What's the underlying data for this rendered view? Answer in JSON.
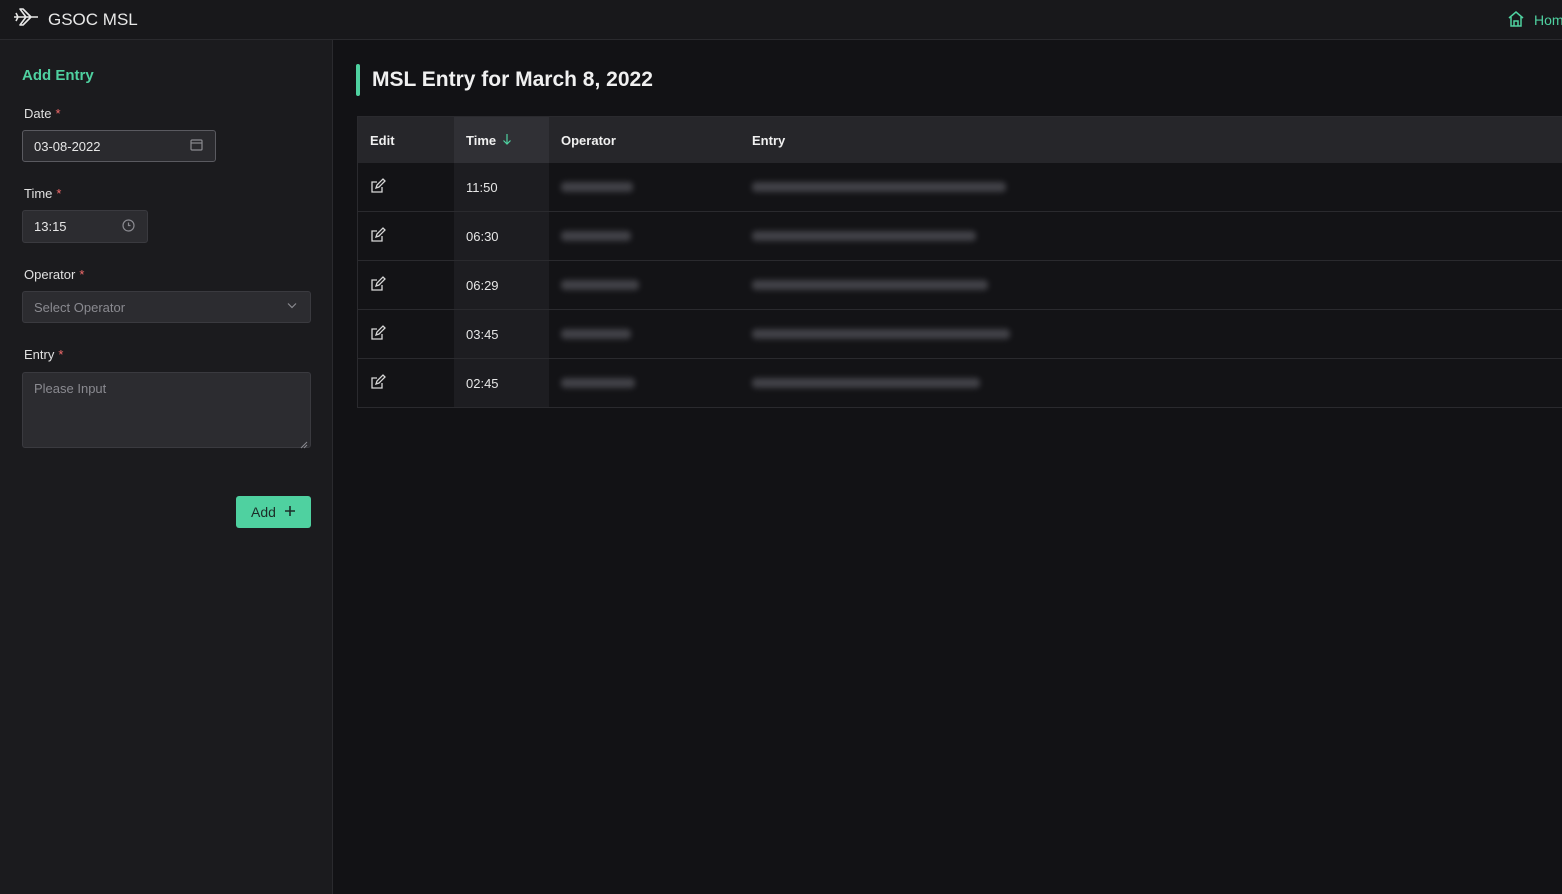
{
  "app": {
    "title": "GSOC MSL",
    "home_label": "Home"
  },
  "sidebar": {
    "title": "Add Entry",
    "date": {
      "label": "Date",
      "value": "03-08-2022"
    },
    "time": {
      "label": "Time",
      "value": "13:15"
    },
    "operator": {
      "label": "Operator",
      "placeholder": "Select Operator"
    },
    "entry": {
      "label": "Entry",
      "placeholder": "Please Input"
    },
    "add_button": "Add",
    "required_mark": "*"
  },
  "main": {
    "heading": "MSL Entry for March 8, 2022",
    "table": {
      "columns": {
        "edit": "Edit",
        "time": "Time",
        "operator": "Operator",
        "entry": "Entry"
      },
      "rows": [
        {
          "time": "11:50"
        },
        {
          "time": "06:30"
        },
        {
          "time": "06:29"
        },
        {
          "time": "03:45"
        },
        {
          "time": "02:45"
        }
      ]
    }
  },
  "colors": {
    "accent": "#4fd1a0",
    "background": "#121215",
    "sidebar": "#1b1b1e",
    "required": "#f56c6c"
  },
  "icons": [
    "plane-icon",
    "home-icon",
    "calendar-icon",
    "clock-icon",
    "chevron-down-icon",
    "edit-icon",
    "sort-down-icon",
    "plus-icon"
  ]
}
